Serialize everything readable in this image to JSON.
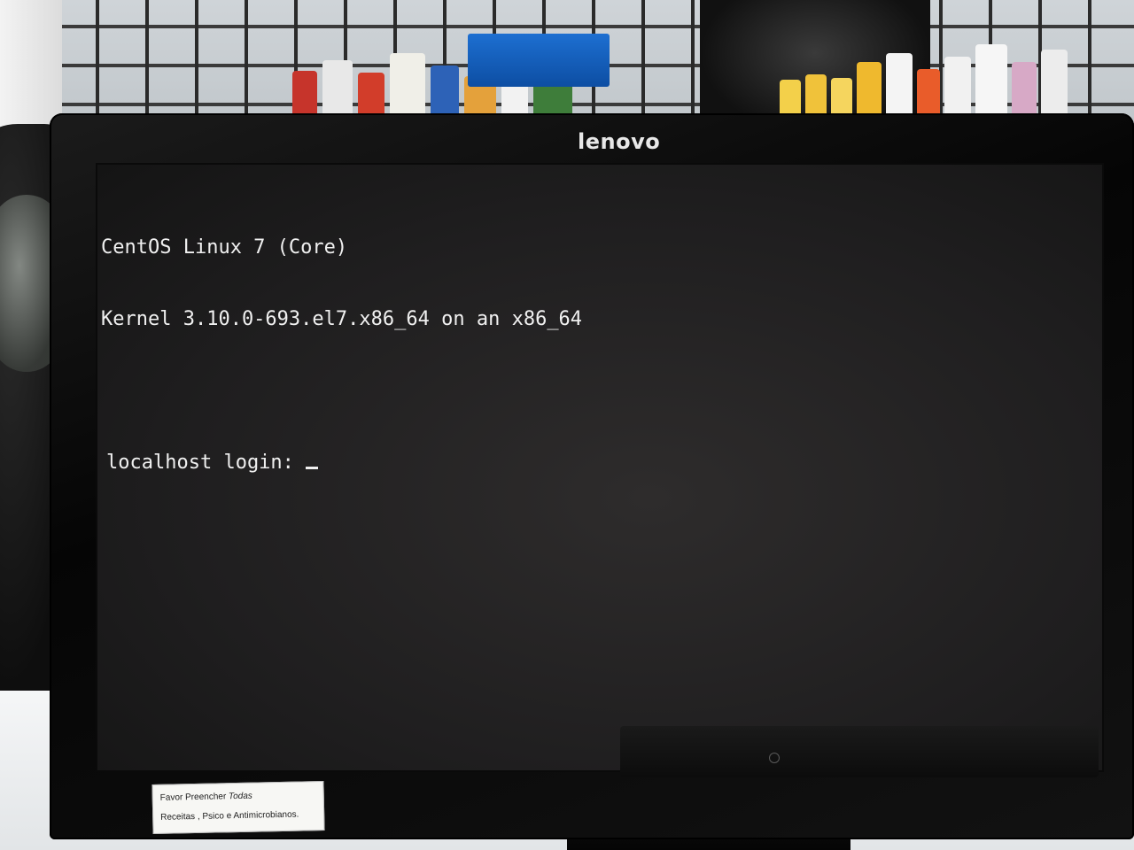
{
  "monitor": {
    "brand": "lenovo"
  },
  "terminal": {
    "lines": [
      "CentOS Linux 7 (Core)",
      "Kernel 3.10.0-693.el7.x86_64 on an x86_64"
    ],
    "login_prompt": "localhost login: "
  },
  "sticker": {
    "line1_prefix": "Favor Preencher ",
    "line1_emphasis": "Todas",
    "line2": "Receitas  , Psico e Antimicrobianos."
  }
}
